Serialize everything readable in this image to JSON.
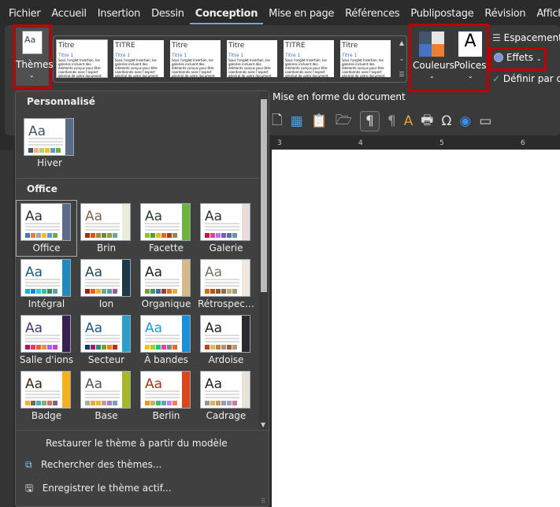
{
  "tabs": [
    "Fichier",
    "Accueil",
    "Insertion",
    "Dessin",
    "Conception",
    "Mise en page",
    "Références",
    "Publipostage",
    "Révision",
    "Affichage"
  ],
  "active_tab": "Conception",
  "ribbon": {
    "themes_label": "Thèmes",
    "colors_label": "Couleurs",
    "fonts_label": "Polices",
    "spacing_label": "Espacement",
    "effects_label": "Effets",
    "default_label": "Définir par d",
    "group_label": "Mise en forme du document",
    "highlight_color": "#c00000"
  },
  "styles": [
    {
      "title": "Titre",
      "sub": "Titre 1"
    },
    {
      "title": "TITRE",
      "sub": "Titre 1"
    },
    {
      "title": "Titre",
      "sub": "Titre 1"
    },
    {
      "title": "Titre",
      "sub": "Titre 1"
    },
    {
      "title": "TITRE",
      "sub": "Titre 1"
    },
    {
      "title": "Titre",
      "sub": "Titre 1"
    }
  ],
  "style_body": "Sous l'onglet Insertion, les galeries incluent des éléments conçus pour être coordonnés avec l'aspect général de votre document.",
  "panel": {
    "custom_header": "Personnalisé",
    "custom": [
      {
        "name": "Hiver",
        "font": "#44546a",
        "accent": "#5a6b88",
        "sw": [
          "#44546a",
          "#f4b183",
          "#a9d18e",
          "#ffc000",
          "#5b9bd5",
          "#70ad47"
        ]
      }
    ],
    "office_header": "Office",
    "themes": [
      {
        "name": "Office",
        "font": "#333",
        "accent": "#5b6b88",
        "sw": [
          "#4472c4",
          "#ed7d31",
          "#a5a5a5",
          "#ffc000",
          "#5b9bd5",
          "#70ad47"
        ]
      },
      {
        "name": "Brin",
        "font": "#7a6a4a",
        "accent": "#e8ecd8",
        "sw": [
          "#a5300f",
          "#d55816",
          "#a6883a",
          "#6e8b3d",
          "#8e9e4a",
          "#6fa78c"
        ]
      },
      {
        "name": "Facette",
        "font": "#2a4030",
        "accent": "#6cb33f",
        "sw": [
          "#90c226",
          "#54a021",
          "#e6b91e",
          "#e76618",
          "#c42f1a",
          "#918655"
        ]
      },
      {
        "name": "Galerie",
        "font": "#333",
        "accent": "#e8dcdc",
        "sw": [
          "#b71e42",
          "#de478e",
          "#bc72f0",
          "#795faf",
          "#586ea6",
          "#6892a0"
        ]
      },
      {
        "name": "Intégral",
        "font": "#1e5a78",
        "accent": "#1e8bbe",
        "sw": [
          "#1cade4",
          "#2683c6",
          "#27ced7",
          "#42ba97",
          "#3e8853",
          "#62a39f"
        ]
      },
      {
        "name": "Ion",
        "font": "#1e4a5a",
        "accent": "#1a3a48",
        "sw": [
          "#b01513",
          "#ea6312",
          "#e6b729",
          "#6aac90",
          "#5f9c9d",
          "#9e5e9b"
        ]
      },
      {
        "name": "Organique",
        "font": "#222",
        "accent": "#d8b888",
        "sw": [
          "#83992a",
          "#3c9770",
          "#44709d",
          "#a23c33",
          "#d97828",
          "#deb340"
        ]
      },
      {
        "name": "Rétrospec…",
        "font": "#6a7a5a",
        "accent": "#f0e8e0",
        "sw": [
          "#d16c16",
          "#b5531a",
          "#8e5a2a",
          "#8f6f4b",
          "#bdb078",
          "#9b9b74"
        ]
      },
      {
        "name": "Salle d'ions",
        "font": "#4a3a6a",
        "accent": "#3a2050",
        "sw": [
          "#b31166",
          "#e33d6f",
          "#e45f3c",
          "#e9943a",
          "#9b6bf2",
          "#d53dd0"
        ]
      },
      {
        "name": "Secteur",
        "font": "#1e5a80",
        "accent": "#2aa0c8",
        "sw": [
          "#053d6a",
          "#a3176f",
          "#2a8b79",
          "#74a22d",
          "#ea7f23",
          "#c8281e"
        ]
      },
      {
        "name": "À bandes",
        "font": "#1e9ad6",
        "accent": "#1a90d8",
        "sw": [
          "#ffc000",
          "#a5d028",
          "#08cc78",
          "#f24099",
          "#828288",
          "#f56617"
        ]
      },
      {
        "name": "Ardoise",
        "font": "#222",
        "accent": "#2a2a2e",
        "sw": [
          "#bc451b",
          "#d3ba68",
          "#bb8640",
          "#ad9277",
          "#a55a43",
          "#ad9d7b"
        ]
      },
      {
        "name": "Badge",
        "font": "#3a2a10",
        "accent": "#f5b120",
        "sw": [
          "#f8b323",
          "#656a59",
          "#46b2b5",
          "#8caa7e",
          "#d36f68",
          "#826276"
        ]
      },
      {
        "name": "Base",
        "font": "#555",
        "accent": "#a8b62a",
        "sw": [
          "#a5b592",
          "#f3a447",
          "#e7bc29",
          "#d092a7",
          "#9c85c0",
          "#809ec2"
        ]
      },
      {
        "name": "Berlin",
        "font": "#9a3a10",
        "accent": "#d84818",
        "sw": [
          "#f09415",
          "#c1b56b",
          "#4baf73",
          "#5aa6c0",
          "#d17df9",
          "#fa7e5c"
        ]
      },
      {
        "name": "Cadrage",
        "font": "#222",
        "accent": "#e8e4dc",
        "sw": [
          "#969696",
          "#d6b56c",
          "#c79a55",
          "#8ba3b5",
          "#a4a0c8",
          "#d17d8a"
        ]
      }
    ],
    "menu": [
      "Restaurer le thème à partir du modèle",
      "Rechercher des thèmes...",
      "Enregistrer le thème actif..."
    ]
  },
  "ruler": [
    "3",
    "4",
    "5",
    "6"
  ]
}
